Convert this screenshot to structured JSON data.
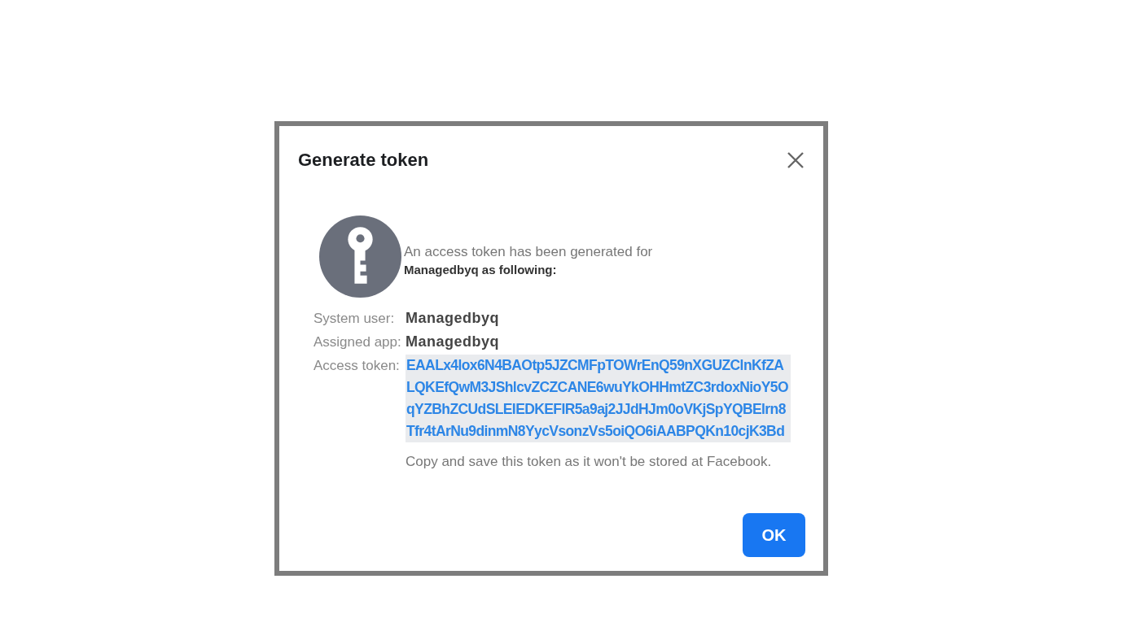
{
  "dialog": {
    "title": "Generate token",
    "message": "An access token has been generated for",
    "message_detail": "Managedbyq as following:",
    "fields": [
      {
        "label": "System user:",
        "value": "Managedbyq",
        "kind": "name"
      },
      {
        "label": "Assigned app:",
        "value": "Managedbyq",
        "kind": "name"
      },
      {
        "label": "Access token:",
        "value": "EAALx4lox6N4BAOtp5JZCMFpTOWrEnQ59nXGUZClnKfZALQKEfQwM3JShlcvZCZCANE6wuYkOHHmtZC3rdoxNioY5OqYZBhZCUdSLEIEDKEFIR5a9aj2JJdHJm0oVKjSpYQBElrn8Tfr4tArNu9dinmN8YycVsonzVs5oiQO6iAABPQKn10cjK3Bd",
        "kind": "token"
      }
    ],
    "note": "Copy and save this token as it won't be stored at Facebook.",
    "buttons": [
      "OK"
    ]
  }
}
